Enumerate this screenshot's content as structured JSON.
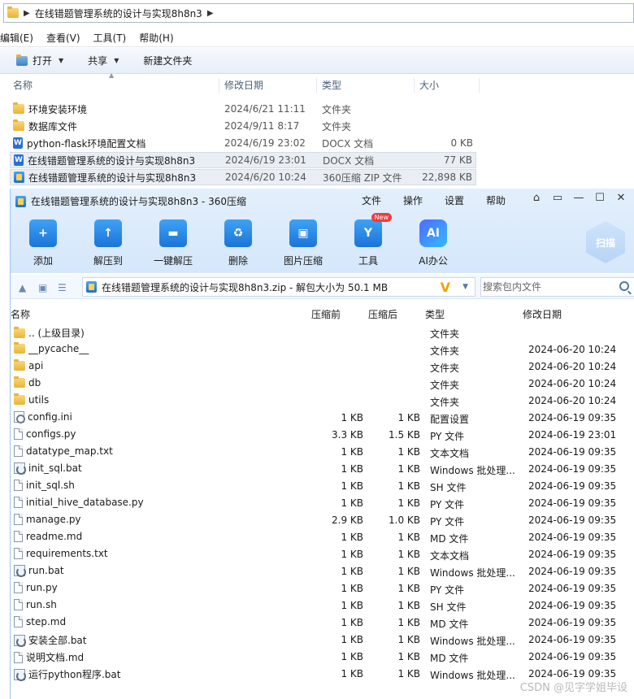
{
  "explorer": {
    "breadcrumb": "在线错题管理系统的设计与实现8h8n3",
    "menu": [
      "编辑(E)",
      "查看(V)",
      "工具(T)",
      "帮助(H)"
    ],
    "toolbar": {
      "open": "打开",
      "share": "共享",
      "new_folder": "新建文件夹"
    },
    "columns": {
      "name": "名称",
      "date": "修改日期",
      "type": "类型",
      "size": "大小"
    },
    "rows": [
      {
        "icon": "folder-icon",
        "name": "环境安装环境",
        "date": "2024/6/21 11:11",
        "type": "文件夹",
        "size": ""
      },
      {
        "icon": "folder-icon",
        "name": "数据库文件",
        "date": "2024/9/11 8:17",
        "type": "文件夹",
        "size": ""
      },
      {
        "icon": "docx-icon",
        "name": "python-flask环境配置文档",
        "date": "2024/6/19 23:02",
        "type": "DOCX 文档",
        "size": "0 KB"
      },
      {
        "icon": "docx-icon",
        "name": "在线错题管理系统的设计与实现8h8n3",
        "date": "2024/6/19 23:01",
        "type": "DOCX 文档",
        "size": "77 KB"
      },
      {
        "icon": "zip-icon",
        "name": "在线错题管理系统的设计与实现8h8n3",
        "date": "2024/6/20 10:24",
        "type": "360压缩 ZIP 文件",
        "size": "22,898 KB"
      }
    ]
  },
  "zip": {
    "title": "在线错题管理系统的设计与实现8h8n3 - 360压缩",
    "menu": [
      "文件",
      "操作",
      "设置",
      "帮助"
    ],
    "ribbon": [
      {
        "label": "添加",
        "icon": "add-icon"
      },
      {
        "label": "解压到",
        "icon": "extract-to-icon"
      },
      {
        "label": "一键解压",
        "icon": "one-click-extract-icon"
      },
      {
        "label": "删除",
        "icon": "delete-icon"
      },
      {
        "label": "图片压缩",
        "icon": "image-compress-icon"
      },
      {
        "label": "工具",
        "icon": "tools-icon",
        "badge": "New"
      },
      {
        "label": "AI办公",
        "icon": "ai-office-icon"
      }
    ],
    "ai_glyph": "AI",
    "scan_label": "扫描",
    "path": "在线错题管理系统的设计与实现8h8n3.zip - 解包大小为 50.1 MB",
    "search_placeholder": "搜索包内文件",
    "columns": {
      "name": "名称",
      "packed_before": "压缩前",
      "packed_after": "压缩后",
      "type": "类型",
      "date": "修改日期"
    },
    "rows": [
      {
        "icon": "folder-icon",
        "name": ".. (上级目录)",
        "before": "",
        "after": "",
        "type": "文件夹",
        "date": ""
      },
      {
        "icon": "folder-icon",
        "name": "__pycache__",
        "before": "",
        "after": "",
        "type": "文件夹",
        "date": "2024-06-20 10:24"
      },
      {
        "icon": "folder-icon",
        "name": "api",
        "before": "",
        "after": "",
        "type": "文件夹",
        "date": "2024-06-20 10:24"
      },
      {
        "icon": "folder-icon",
        "name": "db",
        "before": "",
        "after": "",
        "type": "文件夹",
        "date": "2024-06-20 10:24"
      },
      {
        "icon": "folder-icon",
        "name": "utils",
        "before": "",
        "after": "",
        "type": "文件夹",
        "date": "2024-06-20 10:24"
      },
      {
        "icon": "gear-icon",
        "name": "config.ini",
        "before": "1 KB",
        "after": "1 KB",
        "type": "配置设置",
        "date": "2024-06-19 09:35"
      },
      {
        "icon": "file-icon",
        "name": "configs.py",
        "before": "3.3 KB",
        "after": "1.5 KB",
        "type": "PY 文件",
        "date": "2024-06-19 23:01"
      },
      {
        "icon": "file-icon",
        "name": "datatype_map.txt",
        "before": "1 KB",
        "after": "1 KB",
        "type": "文本文档",
        "date": "2024-06-19 09:35"
      },
      {
        "icon": "bat-icon",
        "name": "init_sql.bat",
        "before": "1 KB",
        "after": "1 KB",
        "type": "Windows 批处理...",
        "date": "2024-06-19 09:35"
      },
      {
        "icon": "file-icon",
        "name": "init_sql.sh",
        "before": "1 KB",
        "after": "1 KB",
        "type": "SH 文件",
        "date": "2024-06-19 09:35"
      },
      {
        "icon": "file-icon",
        "name": "initial_hive_database.py",
        "before": "1 KB",
        "after": "1 KB",
        "type": "PY 文件",
        "date": "2024-06-19 09:35"
      },
      {
        "icon": "file-icon",
        "name": "manage.py",
        "before": "2.9 KB",
        "after": "1.0 KB",
        "type": "PY 文件",
        "date": "2024-06-19 09:35"
      },
      {
        "icon": "file-icon",
        "name": "readme.md",
        "before": "1 KB",
        "after": "1 KB",
        "type": "MD 文件",
        "date": "2024-06-19 09:35"
      },
      {
        "icon": "file-icon",
        "name": "requirements.txt",
        "before": "1 KB",
        "after": "1 KB",
        "type": "文本文档",
        "date": "2024-06-19 09:35"
      },
      {
        "icon": "bat-icon",
        "name": "run.bat",
        "before": "1 KB",
        "after": "1 KB",
        "type": "Windows 批处理...",
        "date": "2024-06-19 09:35"
      },
      {
        "icon": "file-icon",
        "name": "run.py",
        "before": "1 KB",
        "after": "1 KB",
        "type": "PY 文件",
        "date": "2024-06-19 09:35"
      },
      {
        "icon": "file-icon",
        "name": "run.sh",
        "before": "1 KB",
        "after": "1 KB",
        "type": "SH 文件",
        "date": "2024-06-19 09:35"
      },
      {
        "icon": "file-icon",
        "name": "step.md",
        "before": "1 KB",
        "after": "1 KB",
        "type": "MD 文件",
        "date": "2024-06-19 09:35"
      },
      {
        "icon": "bat-icon",
        "name": "安装全部.bat",
        "before": "1 KB",
        "after": "1 KB",
        "type": "Windows 批处理...",
        "date": "2024-06-19 09:35"
      },
      {
        "icon": "file-icon",
        "name": "说明文档.md",
        "before": "1 KB",
        "after": "1 KB",
        "type": "MD 文件",
        "date": "2024-06-19 09:35"
      },
      {
        "icon": "bat-icon",
        "name": "运行python程序.bat",
        "before": "1 KB",
        "after": "1 KB",
        "type": "Windows 批处理...",
        "date": "2024-06-19 09:35"
      }
    ]
  },
  "watermark": "CSDN @见字学姐毕设"
}
